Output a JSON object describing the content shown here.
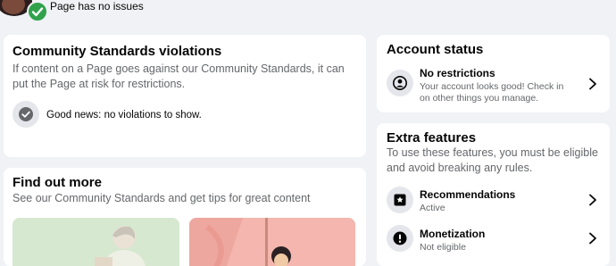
{
  "page_status": {
    "label": "Page has no issues",
    "check_color": "#31a24c"
  },
  "violations": {
    "title": "Community Standards violations",
    "description": "If content on a Page goes against our Community Standards, it can put the Page at risk for restrictions.",
    "status_text": "Good news: no violations to show."
  },
  "find_out_more": {
    "title": "Find out more",
    "description": "See our Community Standards and get tips for great content"
  },
  "account_status": {
    "title": "Account status",
    "item_title": "No restrictions",
    "item_sub": "Your account looks good! Check in on other things you manage."
  },
  "extra_features": {
    "title": "Extra features",
    "description": "To use these features, you must be eligible and avoid breaking any rules.",
    "items": [
      {
        "title": "Recommendations",
        "status": "Active",
        "icon": "recommendations-icon"
      },
      {
        "title": "Monetization",
        "status": "Not eligible",
        "icon": "exclamation-icon"
      }
    ]
  }
}
